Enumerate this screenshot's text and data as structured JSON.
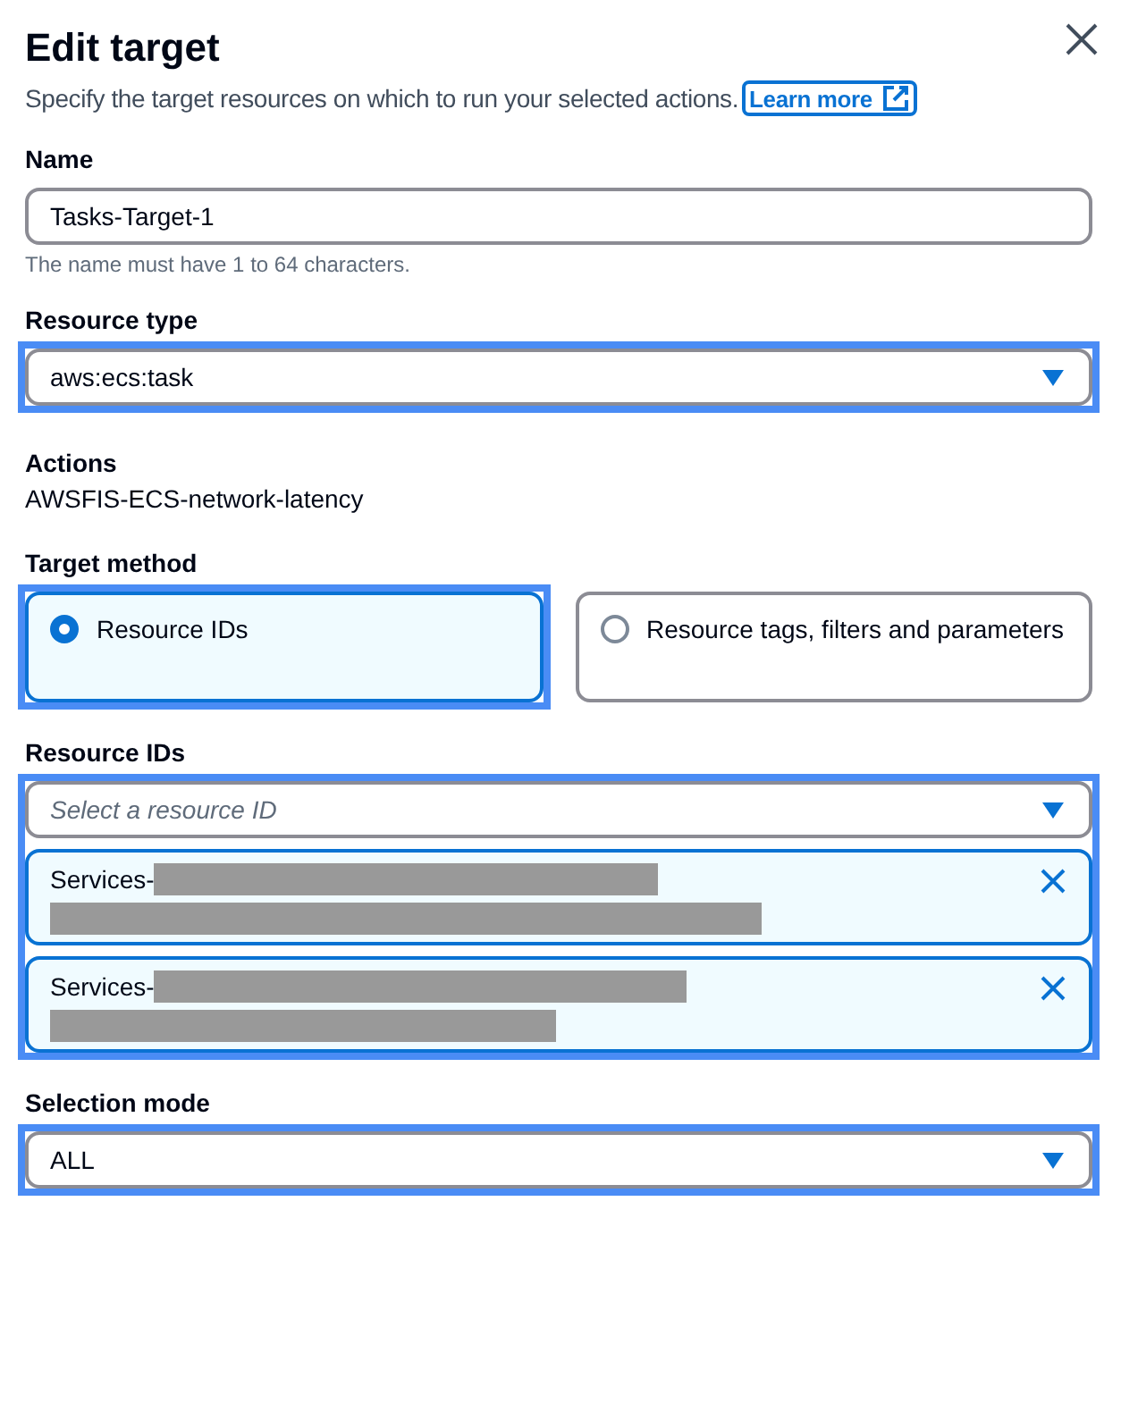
{
  "panel": {
    "title": "Edit target",
    "description": "Specify the target resources on which to run your selected actions.",
    "learn_more": "Learn more"
  },
  "name_field": {
    "label": "Name",
    "value": "Tasks-Target-1",
    "hint": "The name must have 1 to 64 characters.",
    "highlighted": false
  },
  "resource_type": {
    "label": "Resource type",
    "value": "aws:ecs:task",
    "highlighted": true
  },
  "actions": {
    "label": "Actions",
    "value": "AWSFIS-ECS-network-latency"
  },
  "target_method": {
    "label": "Target method",
    "options": [
      {
        "label": "Resource IDs",
        "selected": true,
        "highlighted": true
      },
      {
        "label": "Resource tags, filters and parameters",
        "selected": false,
        "highlighted": false
      }
    ]
  },
  "resource_ids": {
    "label": "Resource IDs",
    "placeholder": "Select a resource ID",
    "highlighted": true,
    "tokens": [
      {
        "label": "Services-",
        "redacted": true,
        "wide": true
      },
      {
        "label": "Services-",
        "redacted": true,
        "wide": false
      }
    ]
  },
  "selection_mode": {
    "label": "Selection mode",
    "value": "ALL",
    "highlighted": true
  }
}
